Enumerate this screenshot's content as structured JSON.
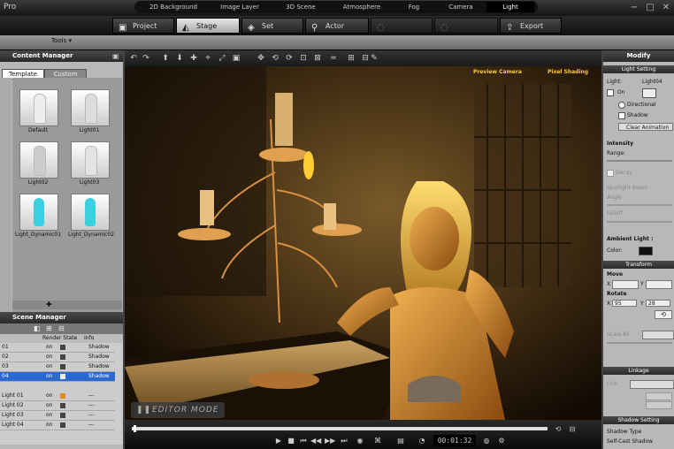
{
  "app": {
    "title": "Pro"
  },
  "main_tabs": [
    {
      "label": "Project"
    },
    {
      "label": "Stage"
    },
    {
      "label": "Set"
    },
    {
      "label": "Actor"
    },
    {
      "label": ""
    },
    {
      "label": ""
    },
    {
      "label": "Export"
    }
  ],
  "toolbar": {
    "tools_label": "Tools ▾"
  },
  "sub_tabs": [
    "2D Background",
    "Image Layer",
    "3D Scene",
    "Atmosphere",
    "Fog",
    "Camera",
    "Light"
  ],
  "content_manager": {
    "title": "Content Manager",
    "tabs": [
      "Template",
      "Custom"
    ],
    "items": [
      "Default",
      "Light01",
      "Light02",
      "Light03",
      "Light_Dynamic01",
      "Light_Dynamic02"
    ]
  },
  "scene_manager": {
    "title": "Scene Manager",
    "headers": [
      "Render State",
      "Info"
    ],
    "rows": [
      {
        "name": "01",
        "state": "on",
        "info": "Shadow"
      },
      {
        "name": "02",
        "state": "on",
        "info": "Shadow"
      },
      {
        "name": "03",
        "state": "on",
        "info": "Shadow"
      },
      {
        "name": "04",
        "state": "on",
        "info": "Shadow"
      },
      {
        "name": "Light 01",
        "state": "on",
        "info": "---"
      },
      {
        "name": "Light 02",
        "state": "on",
        "info": "---"
      },
      {
        "name": "Light 03",
        "state": "on",
        "info": "---"
      },
      {
        "name": "Light 04",
        "state": "on",
        "info": "---"
      }
    ]
  },
  "viewport": {
    "preview_camera": "Preview Camera",
    "pixel_shading": "Pixel Shading",
    "editor_mode": "EDITOR MODE"
  },
  "timeline": {
    "timecode": "00:01:32"
  },
  "modify": {
    "title": "Modify",
    "light_setting": "Light Setting",
    "light_label": "Light:",
    "light_value": "Light04",
    "on_label": "On",
    "directional": "Directional",
    "shadow": "Shadow",
    "clear_animation": "Clear Animation",
    "intensity": "Intensity",
    "range": "Range:",
    "decay": "Decay",
    "spotlight_beam": "Spotlight Beam",
    "angle": "Angle",
    "falloff": "Falloff",
    "ambient_light": "Ambient Light :",
    "color": "Color:",
    "transform": "Transform",
    "move": "Move",
    "x": "X",
    "y": "Y",
    "rotate": "Rotate",
    "rot_x": "95",
    "rot_y": "28",
    "scale": "Scale All",
    "linkage": "Linkage",
    "link": "Link",
    "shadow_setting": "Shadow Setting",
    "shadow_type": "Shadow Type",
    "self_cast": "Self-Cast Shadow"
  },
  "colors": {
    "accent": "#2a6ad0",
    "highlight": "#ffcc33"
  }
}
